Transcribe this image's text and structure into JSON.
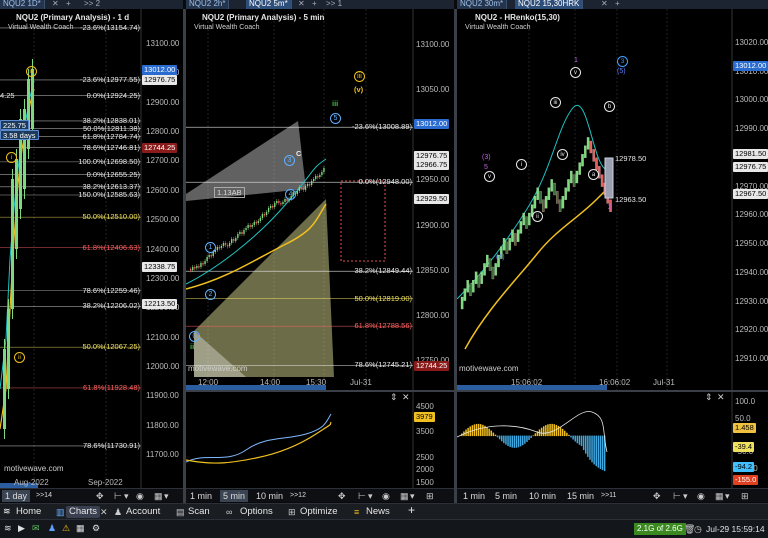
{
  "tabs": [
    {
      "label": "NQU2 1D*"
    },
    {
      "label": "NQU2 2h*"
    },
    {
      "label": "NQU2 5m*",
      "active": true
    },
    {
      "label": "NQU2 30m*"
    },
    {
      "label": "NQU2 15,30HRK",
      "active": true
    }
  ],
  "tab_extras": {
    "more_left": ">> 2",
    "more_mid": ">> 1",
    "add": "+"
  },
  "panel1": {
    "title": "NQU2 (Primary Analysis) - 1 d",
    "subtitle": "Virtual Wealth Coach",
    "price_axis": [
      "13100.00",
      "13000.00",
      "12900.00",
      "12800.00",
      "12700.00",
      "12600.00",
      "12500.00",
      "12400.00",
      "12300.00",
      "12200.00",
      "12100.00",
      "12000.00",
      "11900.00",
      "11800.00",
      "11700.00"
    ],
    "fib_levels": [
      {
        "label": "-23.6%(13154.74)",
        "color": "#e8e8e8"
      },
      {
        "label": "-23.6%(12977.55)",
        "color": "#e8e8e8"
      },
      {
        "label": "0.0%(12924.25)",
        "color": "#e8e8e8"
      },
      {
        "label": "38.2%(12838.01)",
        "color": "#e8e8e8"
      },
      {
        "label": "50.0%(12811.38)",
        "color": "#e8e8e8"
      },
      {
        "label": "61.8%(12784.74)",
        "color": "#e8e8e8"
      },
      {
        "label": "78.6%(12746.81)",
        "color": "#e8e8e8"
      },
      {
        "label": "100.0%(12698.50)",
        "color": "#e8e8e8"
      },
      {
        "label": "0.0%(12655.25)",
        "color": "#e8e8e8"
      },
      {
        "label": "38.2%(12613.37)",
        "color": "#e8e8e8"
      },
      {
        "label": "150.0%(12585.63)",
        "color": "#e8e8e8"
      },
      {
        "label": "50.0%(12510.00)",
        "color": "#f0e060"
      },
      {
        "label": "61.8%(12406.63)",
        "color": "#ff6060"
      },
      {
        "label": "78.6%(12259.46)",
        "color": "#e8e8e8"
      },
      {
        "label": "38.2%(12206.02)",
        "color": "#e8e8e8"
      },
      {
        "label": "50.0%(12067.25)",
        "color": "#f0e060"
      },
      {
        "label": "61.8%(11928.48)",
        "color": "#ff6060"
      },
      {
        "label": "78.6%(11730.91)",
        "color": "#e8e8e8"
      }
    ],
    "price_tags": [
      {
        "label": "13012.00",
        "bg": "#2a6bd0",
        "fg": "#fff"
      },
      {
        "label": "12976.75",
        "bg": "#e8e8e8",
        "fg": "#000"
      },
      {
        "label": "12744.25",
        "bg": "#8b1a1a",
        "fg": "#fff"
      },
      {
        "label": "12338.75",
        "bg": "#e8e8e8",
        "fg": "#000"
      },
      {
        "label": "12213.50",
        "bg": "#e8e8e8",
        "fg": "#000"
      }
    ],
    "left_labels": [
      "4.25",
      "225.75",
      "3.58 days"
    ],
    "wave_labels": [
      "iii",
      "i",
      "ii"
    ],
    "time_axis": [
      "Aug-2022",
      "Sep-2022"
    ],
    "watermark": "motivewave.com",
    "ctrl": {
      "interval": "1 day",
      "more": ">>14"
    }
  },
  "panel2": {
    "title": "NQU2 (Primary Analysis) - 5 min",
    "subtitle": "Virtual Wealth Coach",
    "price_axis": [
      "13100.00",
      "13050.00",
      "12950.00",
      "12900.00",
      "12850.00",
      "12800.00",
      "12750.00"
    ],
    "fib_levels": [
      {
        "label": "-23.6%(13008.89)",
        "color": "#e8e8e8"
      },
      {
        "label": "0.0%(12948.00)",
        "color": "#e8e8e8"
      },
      {
        "label": "38.2%(12849.44)",
        "color": "#e8e8e8"
      },
      {
        "label": "50.0%(12819.00)",
        "color": "#f0e060"
      },
      {
        "label": "61.8%(12788.56)",
        "color": "#ff6060"
      },
      {
        "label": "78.6%(12745.21)",
        "color": "#e8e8e8"
      }
    ],
    "price_tags": [
      {
        "label": "13012.00",
        "bg": "#2a6bd0",
        "fg": "#fff"
      },
      {
        "label": "12976.75",
        "bg": "#e8e8e8",
        "fg": "#000"
      },
      {
        "label": "12966.75",
        "bg": "#e8e8e8",
        "fg": "#000"
      },
      {
        "label": "12929.50",
        "bg": "#e8e8e8",
        "fg": "#000"
      },
      {
        "label": "12744.25",
        "bg": "#8b1a1a",
        "fg": "#fff"
      }
    ],
    "box_label": "1.13AB",
    "wave_labels": [
      "iii",
      "(v)",
      "iii",
      "5",
      "3",
      "C",
      "4",
      "1",
      "2",
      "0",
      "ii"
    ],
    "time_axis": [
      "12:00",
      "14:00",
      "15:30",
      "Jul-31"
    ],
    "watermark": "motivewave.com",
    "osc_axis": [
      "4500",
      "4000",
      "3500",
      "2500",
      "2000",
      "1500"
    ],
    "osc_tag": "3979",
    "ctrl": {
      "intervals": [
        "1 min",
        "5 min",
        "10 min"
      ],
      "more": ">>12",
      "selected": "5 min"
    }
  },
  "panel3": {
    "title": "NQU2 - HRenko(15,30)",
    "subtitle": "Virtual Wealth Coach",
    "price_axis": [
      "13020.00",
      "13010.00",
      "13000.00",
      "12990.00",
      "12970.00",
      "12960.00",
      "12950.00",
      "12940.00",
      "12930.00",
      "12920.00",
      "12910.00"
    ],
    "price_tags": [
      {
        "label": "13012.00",
        "bg": "#2a6bd0",
        "fg": "#fff"
      },
      {
        "label": "12981.50",
        "bg": "#e8e8e8",
        "fg": "#000"
      },
      {
        "label": "12976.75",
        "bg": "#e8e8e8",
        "fg": "#000"
      },
      {
        "label": "12967.50",
        "bg": "#e8e8e8",
        "fg": "#000"
      }
    ],
    "box_labels": [
      "12978.50",
      "12963.50"
    ],
    "wave_labels": [
      "1",
      "3",
      "(5)",
      "v",
      "iii",
      "b",
      "iv",
      "i",
      "v",
      "ii",
      "(3)",
      "5",
      "(4)",
      "a",
      "2"
    ],
    "time_axis": [
      "15:06:02",
      "16:06:02",
      "Jul-31"
    ],
    "watermark": "motivewave.com",
    "osc_axis": [
      "100.0",
      "50.0",
      "-50.0",
      "-100.0"
    ],
    "osc_tags": [
      {
        "label": "1.458",
        "bg": "#f0c040",
        "fg": "#000"
      },
      {
        "label": "-39.4",
        "bg": "#f0e060",
        "fg": "#000"
      },
      {
        "label": "-94.2",
        "bg": "#40c0ff",
        "fg": "#000"
      },
      {
        "label": "-155.0",
        "bg": "#e04020",
        "fg": "#fff"
      }
    ],
    "ctrl": {
      "intervals": [
        "1 min",
        "5 min",
        "10 min",
        "15 min"
      ],
      "more": ">>11"
    }
  },
  "nav": {
    "home": "Home",
    "charts": "Charts",
    "account": "Account",
    "scan": "Scan",
    "options": "Options",
    "optimize": "Optimize",
    "news": "News",
    "add": "+"
  },
  "status": {
    "memory": "2.1G of 2.6G",
    "datetime": "Jul-29 15:59:14"
  },
  "colors": {
    "up": "#7fd77f",
    "down": "#e06060",
    "ma_yellow": "#f0c020",
    "ma_cyan": "#20c0c0",
    "fib_yellow": "#f0e060",
    "fib_red": "#ff6060"
  }
}
